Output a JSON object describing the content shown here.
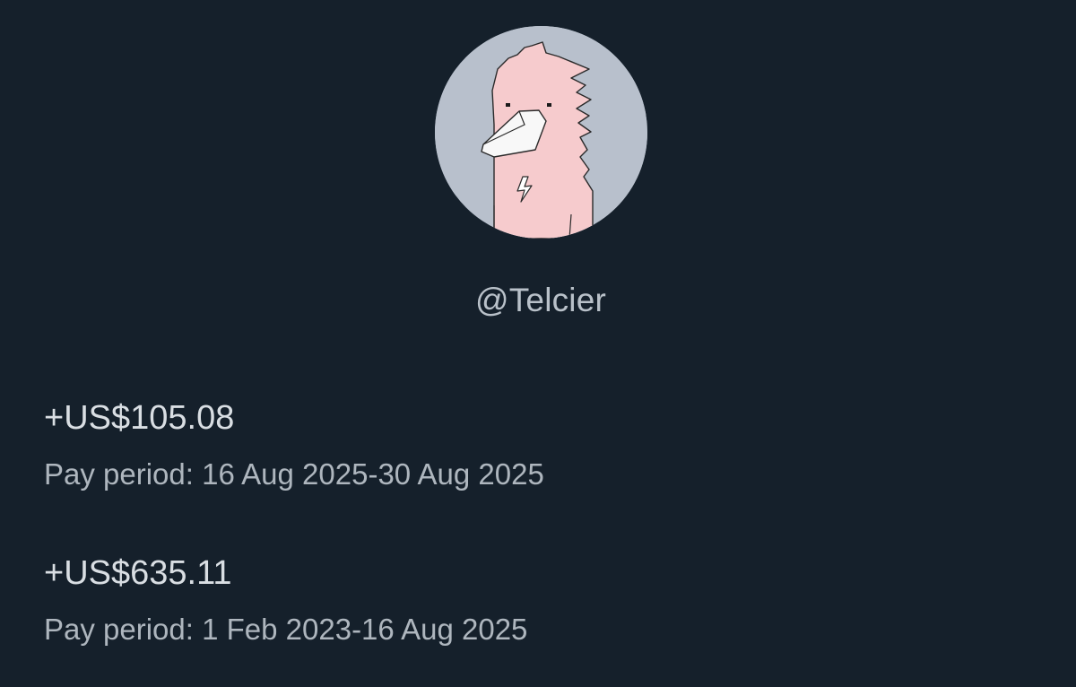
{
  "profile": {
    "handle": "@Telcier",
    "avatar_icon": "pink-platypus-avatar"
  },
  "payments": [
    {
      "amount": "+US$105.08",
      "period": "Pay period: 16 Aug 2025-30 Aug 2025"
    },
    {
      "amount": "+US$635.11",
      "period": "Pay period: 1 Feb 2023-16 Aug 2025"
    }
  ],
  "colors": {
    "background": "#15202b",
    "text_primary": "#d9dee3",
    "text_secondary": "#aeb6be",
    "avatar_bg": "#b8c0cc",
    "character_pink": "#f5c9cb"
  }
}
